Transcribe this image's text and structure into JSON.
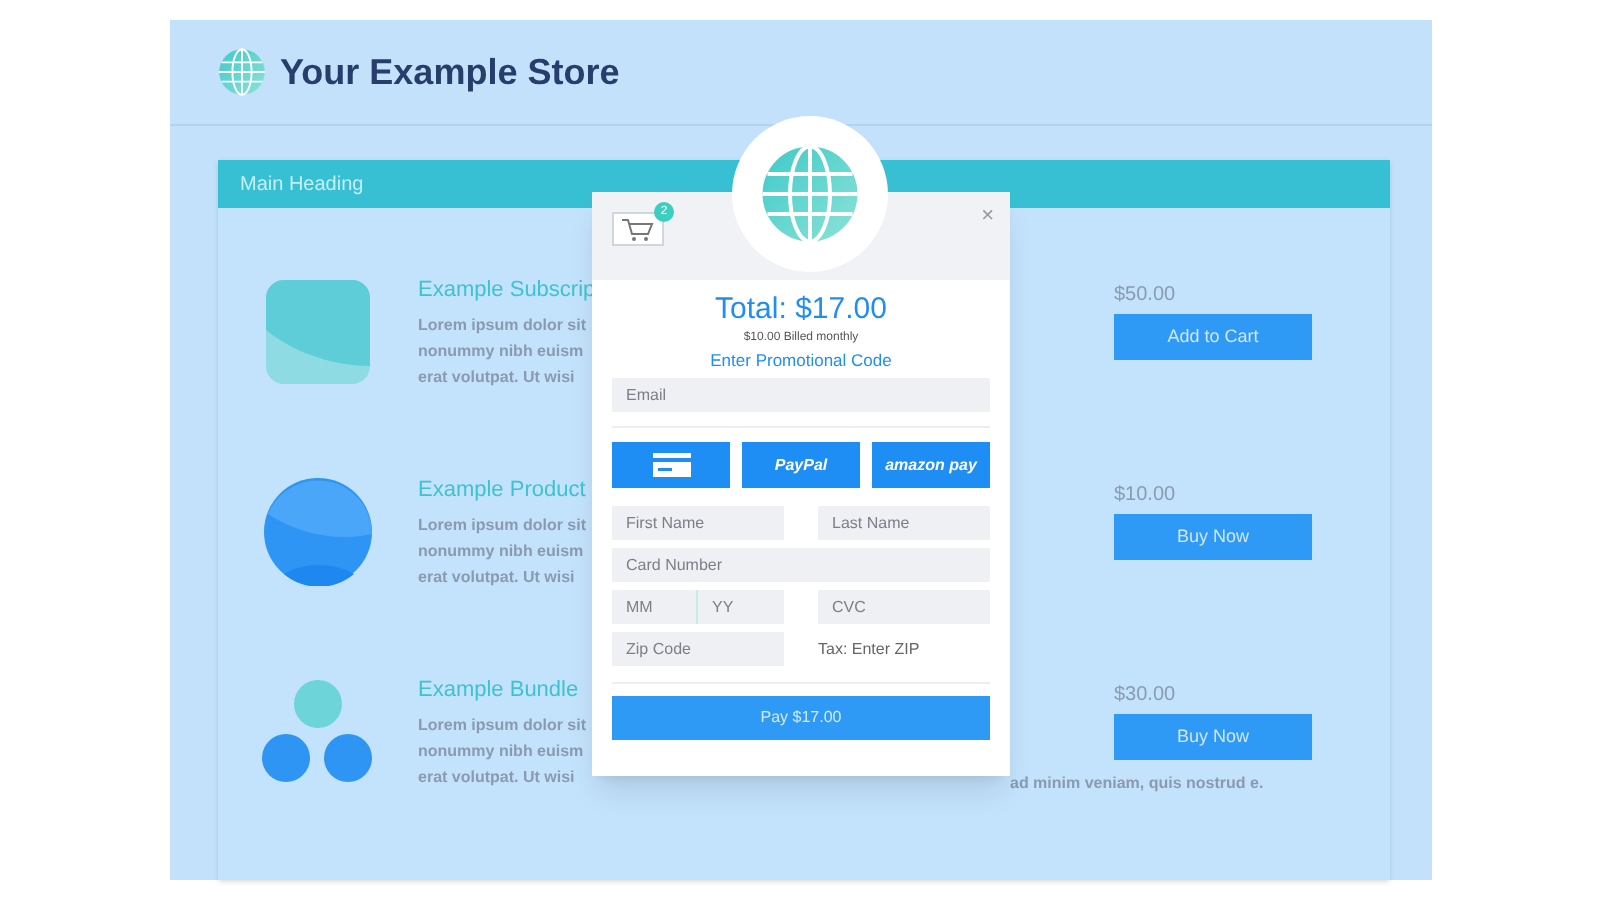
{
  "store": {
    "title": "Your Example Store"
  },
  "main_heading": "Main Heading",
  "products": [
    {
      "kind": "square",
      "title": "Example Subscrip",
      "lines": [
        "Lorem ipsum dolor sit",
        "nonummy nibh euism",
        "erat volutpat. Ut wisi"
      ],
      "price": "$50.00",
      "button": "Add to Cart"
    },
    {
      "kind": "circle",
      "title": "Example Product",
      "lines": [
        "Lorem ipsum dolor sit",
        "nonummy nibh euism",
        "erat volutpat. Ut wisi"
      ],
      "price": "$10.00",
      "button": "Buy Now"
    },
    {
      "kind": "cluster",
      "title": "Example Bundle",
      "lines": [
        "Lorem ipsum dolor sit",
        "nonummy nibh euism",
        "erat volutpat. Ut wisi"
      ],
      "continued": "ad minim veniam, quis nostrud e.",
      "price": "$30.00",
      "button": "Buy Now"
    }
  ],
  "checkout": {
    "cart_count": "2",
    "close": "×",
    "total": "Total: $17.00",
    "billing": "$10.00 Billed monthly",
    "promo_link": "Enter Promotional Code",
    "email": {
      "placeholder": "Email"
    },
    "pay_methods": [
      {
        "kind": "card"
      },
      {
        "kind": "text",
        "label": "PayPal"
      },
      {
        "kind": "text",
        "label": "amazon pay"
      }
    ],
    "first_name": {
      "placeholder": "First Name"
    },
    "last_name": {
      "placeholder": "Last Name"
    },
    "card_number": {
      "placeholder": "Card Number"
    },
    "month": {
      "placeholder": "MM"
    },
    "year": {
      "placeholder": "YY"
    },
    "cvc": {
      "placeholder": "CVC"
    },
    "zip": {
      "placeholder": "Zip Code"
    },
    "tax": "Tax: Enter ZIP",
    "pay_button": "Pay $17.00"
  }
}
